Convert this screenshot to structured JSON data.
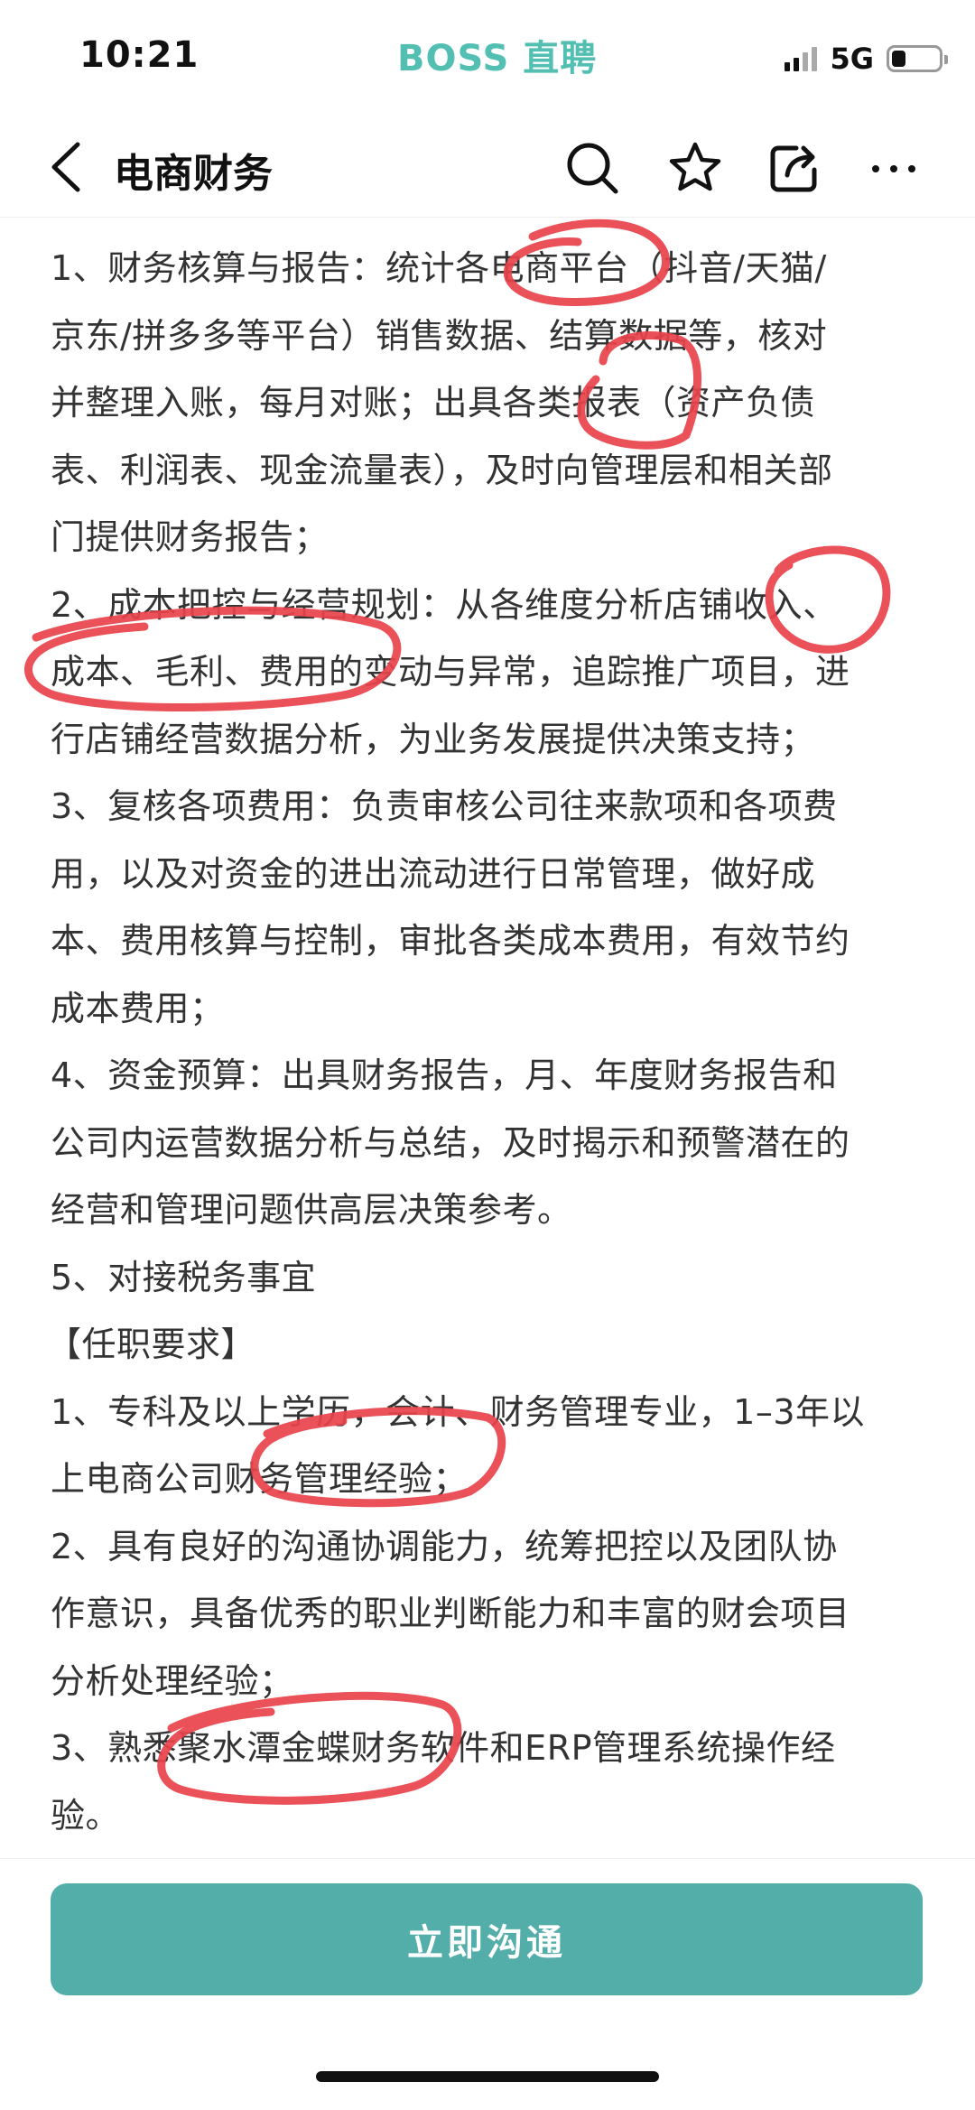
{
  "status_bar": {
    "time": "10:21",
    "brand": "BOSS 直聘",
    "network": "5G",
    "battery_level": 0.3
  },
  "nav": {
    "title": "电商财务",
    "back_icon": "chevron-left-icon",
    "actions": [
      "search-icon",
      "star-icon",
      "share-icon",
      "more-icon"
    ]
  },
  "description": {
    "lines": [
      "1、财务核算与报告：统计各电商平台（抖音/天猫/",
      "京东/拼多多等平台）销售数据、结算数据等，核对",
      "并整理入账，每月对账；出具各类报表（资产负债",
      "表、利润表、现金流量表），及时向管理层和相关部",
      "门提供财务报告；",
      "2、成本把控与经营规划：从各维度分析店铺收入、",
      "成本、毛利、费用的变动与异常，追踪推广项目，进",
      "行店铺经营数据分析，为业务发展提供决策支持；",
      "3、复核各项费用：负责审核公司往来款项和各项费",
      "用，以及对资金的进出流动进行日常管理，做好成",
      "本、费用核算与控制，审批各类成本费用，有效节约",
      "成本费用；",
      "4、资金预算：出具财务报告，月、年度财务报告和",
      "公司内运营数据分析与总结，及时揭示和预警潜在的",
      "经营和管理问题供高层决策参考。",
      "5、对接税务事宜",
      "【任职要求】",
      "1、专科及以上学历，会计、财务管理专业，1–3年以",
      "上电商公司财务管理经验；",
      "2、具有良好的沟通协调能力，统筹把控以及团队协",
      "作意识，具备优秀的职业判断能力和丰富的财会项目",
      "分析处理经验；",
      "3、熟悉聚水潭金蝶财务软件和ERP管理系统操作经",
      "验。"
    ]
  },
  "footer": {
    "cta_label": "立即沟通"
  },
  "colors": {
    "brand": "#53bfb3",
    "cta": "#53aea9",
    "annotation": "#e8424a"
  }
}
